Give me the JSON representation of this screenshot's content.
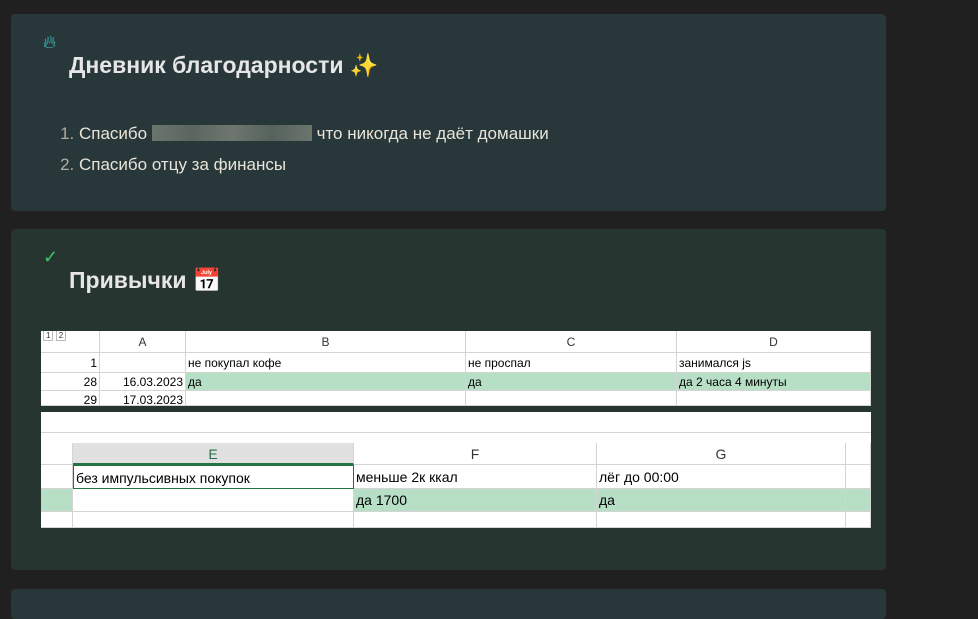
{
  "gratitude": {
    "title": "Дневник благодарности",
    "emoji": "✨",
    "items": [
      {
        "before": "Спасибо",
        "after": "что никогда не даёт домашки"
      },
      {
        "text": "Спасибо отцу за финансы"
      }
    ]
  },
  "habits": {
    "title": "Привычки",
    "emoji": "📅",
    "sheet1": {
      "outline": [
        "1",
        "2"
      ],
      "cols": [
        "A",
        "B",
        "C",
        "D"
      ],
      "rows": [
        {
          "num": "1",
          "cells": [
            "",
            "не покупал кофе",
            "не проспал",
            "занимался js"
          ]
        },
        {
          "num": "28",
          "cells": [
            "16.03.2023",
            "да",
            "да",
            "да 2 часа 4 минуты"
          ]
        },
        {
          "num": "29",
          "cells": [
            "17.03.2023",
            "",
            "",
            ""
          ]
        }
      ]
    },
    "sheet2": {
      "cols": [
        "E",
        "F",
        "G"
      ],
      "rows": [
        {
          "cells": [
            "без импульсивных покупок",
            "меньше 2к ккал",
            "лёг до 00:00"
          ]
        },
        {
          "cells": [
            "",
            "да 1700",
            "да"
          ]
        }
      ]
    }
  }
}
